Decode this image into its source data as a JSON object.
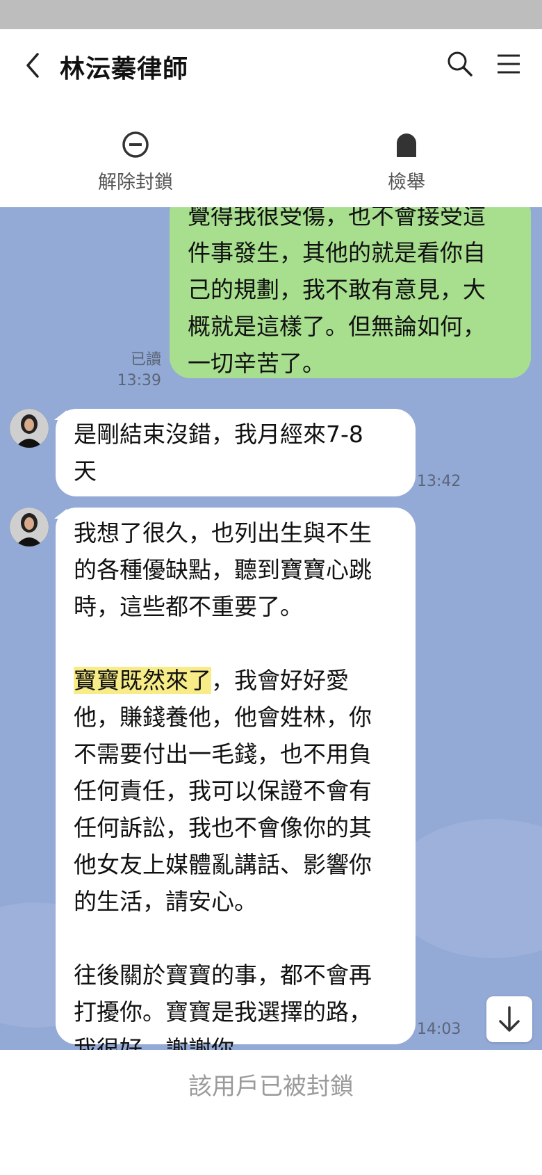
{
  "header": {
    "title": "林沄蓁律師"
  },
  "actions": {
    "unblock_label": "解除封鎖",
    "report_label": "檢舉"
  },
  "messages": {
    "m1": {
      "text": "覺得我很受傷，也不會接受這\n件事發生，其他的就是看你自\n己的規劃，我不敢有意見，大\n概就是這樣了。但無論如何，\n一切辛苦了。",
      "read": "已讀",
      "time": "13:39"
    },
    "m2": {
      "text": "是剛結束沒錯，我月經來7-8\n天",
      "time": "13:42"
    },
    "m3": {
      "part1": "我想了很久，也列出生與不生\n的各種優缺點，聽到寶寶心跳\n時，這些都不重要了。",
      "highlight": "寶寶既然來了",
      "part2": "，我會好好愛\n他，賺錢養他，他會姓林，你\n不需要付出一毛錢，也不用負\n任何責任，我可以保證不會有\n任何訴訟，我也不會像你的其\n他女友上媒體亂講話、影響你\n的生活，請安心。",
      "part3": "往後關於寶寶的事，都不會再\n打擾你。寶寶是我選擇的路，\n我很好，謝謝你。",
      "time": "14:03"
    }
  },
  "footer": {
    "blocked_text": "該用戶已被封鎖"
  },
  "icons": {
    "back": "chevron-left-icon",
    "search": "search-icon",
    "menu": "hamburger-menu-icon",
    "unblock": "minus-circle-icon",
    "report": "report-icon",
    "scroll": "arrow-down-icon"
  },
  "colors": {
    "chat_bg": "#93a9d6",
    "my_bubble": "#a8df8f",
    "their_bubble": "#ffffff",
    "highlight": "#f7ec87"
  }
}
